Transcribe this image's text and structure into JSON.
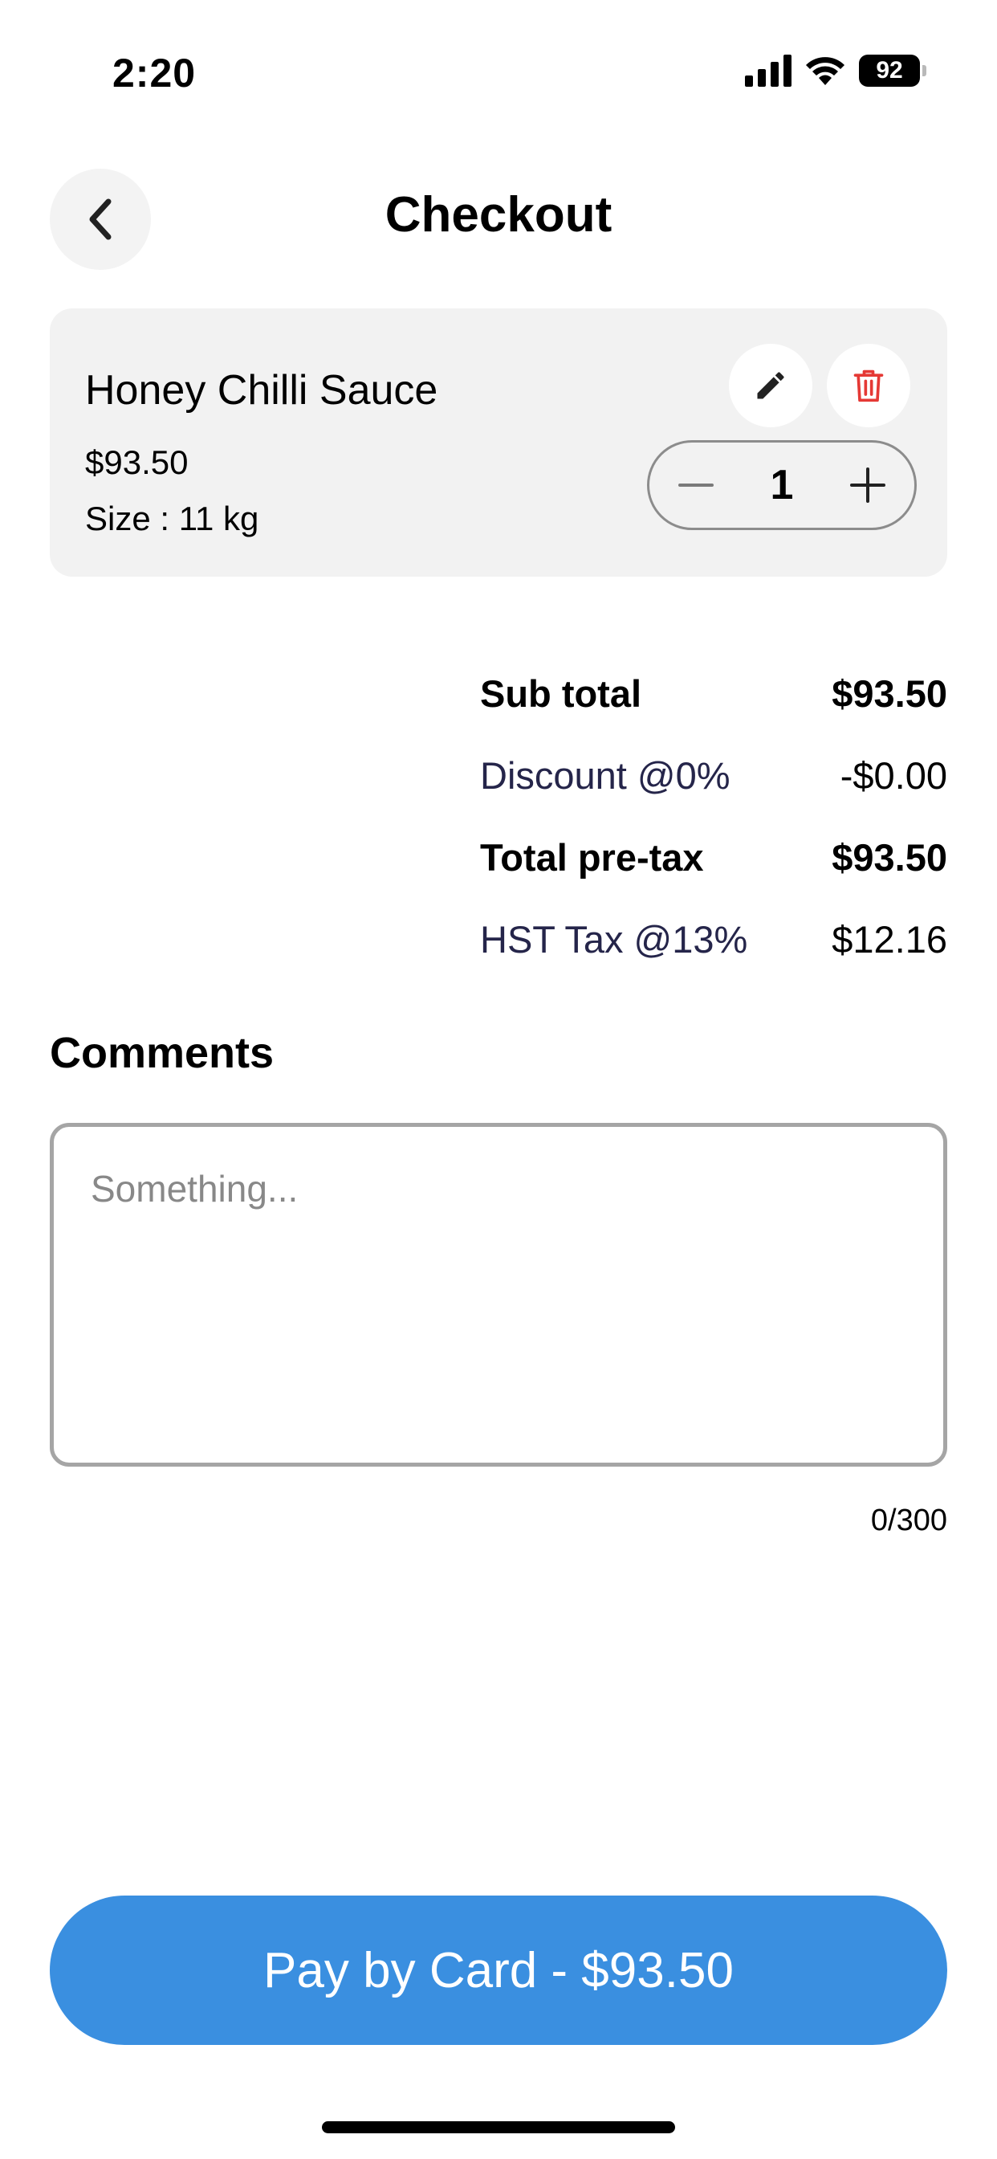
{
  "status_bar": {
    "time": "2:20",
    "battery": "92",
    "icons": [
      "cellular-signal-icon",
      "wifi-icon",
      "battery-icon"
    ]
  },
  "header": {
    "title": "Checkout",
    "back_icon": "chevron-left-icon"
  },
  "cart_item": {
    "name": "Honey Chilli Sauce",
    "price": "$93.50",
    "size": "Size : 11 kg",
    "quantity": "1",
    "edit_icon": "pencil-icon",
    "delete_icon": "trash-icon",
    "decrement_icon": "minus-icon",
    "increment_icon": "plus-icon"
  },
  "totals": {
    "subtotal_label": "Sub total",
    "subtotal_value": "$93.50",
    "discount_label": "Discount @0%",
    "discount_value": "-$0.00",
    "pretax_label": "Total pre-tax",
    "pretax_value": "$93.50",
    "tax_label": "HST Tax @13%",
    "tax_value": "$12.16"
  },
  "comments": {
    "title": "Comments",
    "placeholder": "Something...",
    "value": "",
    "counter": "0/300"
  },
  "pay_button": {
    "label": "Pay by Card - $93.50"
  },
  "colors": {
    "primary": "#3a8fe0",
    "delete": "#e53935",
    "card_bg": "#f2f2f2"
  }
}
